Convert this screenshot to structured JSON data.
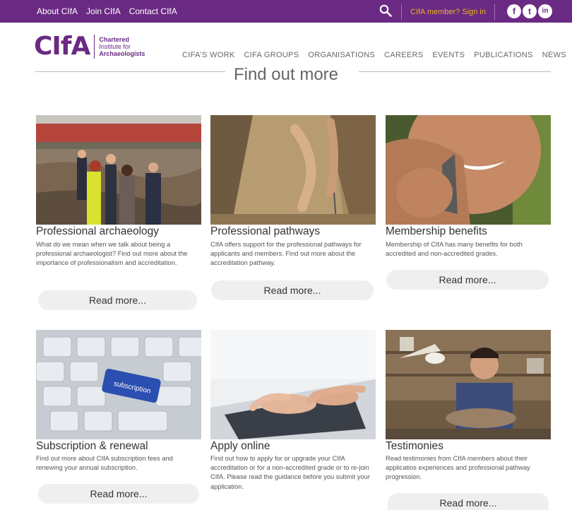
{
  "topbar": {
    "links": [
      "About CIfA",
      "Join CIfA",
      "Contact CIfA"
    ],
    "signin": "CIfA member? Sign in",
    "social": [
      "f",
      "t",
      "in"
    ]
  },
  "logo": {
    "mark": "CIfA",
    "line1": "Chartered",
    "line2": "Institute for",
    "line3": "Archaeologists"
  },
  "nav": [
    "CIFA'S WORK",
    "CIFA GROUPS",
    "ORGANISATIONS",
    "CAREERS",
    "EVENTS",
    "PUBLICATIONS",
    "NEWS"
  ],
  "section_title": "Find out more",
  "cards": [
    {
      "title": "Professional archaeology",
      "desc": "What do we mean when we talk about being a professional archaeologist? Find out more about the importance of professionalism and accreditation.",
      "more": "Read more..."
    },
    {
      "title": "Professional pathways",
      "desc": "CIfA offers support for the professional pathways for applicants and members. Find out more about the accreditation pathway.",
      "more": "Read more..."
    },
    {
      "title": "Membership benefits",
      "desc": "Membership of CIfA has many benefits for both accredited and non-accredited grades.",
      "more": "Read more..."
    },
    {
      "title": "Subscription & renewal",
      "desc": "Find out more about CIfA subscription fees and renewing your annual subscription.",
      "more": "Read more..."
    },
    {
      "title": "Apply online",
      "desc": "Find out how to apply for or upgrade your CIfA accreditation or for a non-accredited grade or to re-join CIfA. Please read the guidance before you submit your application.",
      "more": "Read more..."
    },
    {
      "title": "Testimonies",
      "desc": "Read testimonies from CIfA members about their applicatios experiences and professional pathway progression.",
      "more": "Read more..."
    }
  ],
  "keyboard_label": "subscription",
  "colors": {
    "brand": "#6a2a83",
    "accent": "#e9b41b"
  }
}
